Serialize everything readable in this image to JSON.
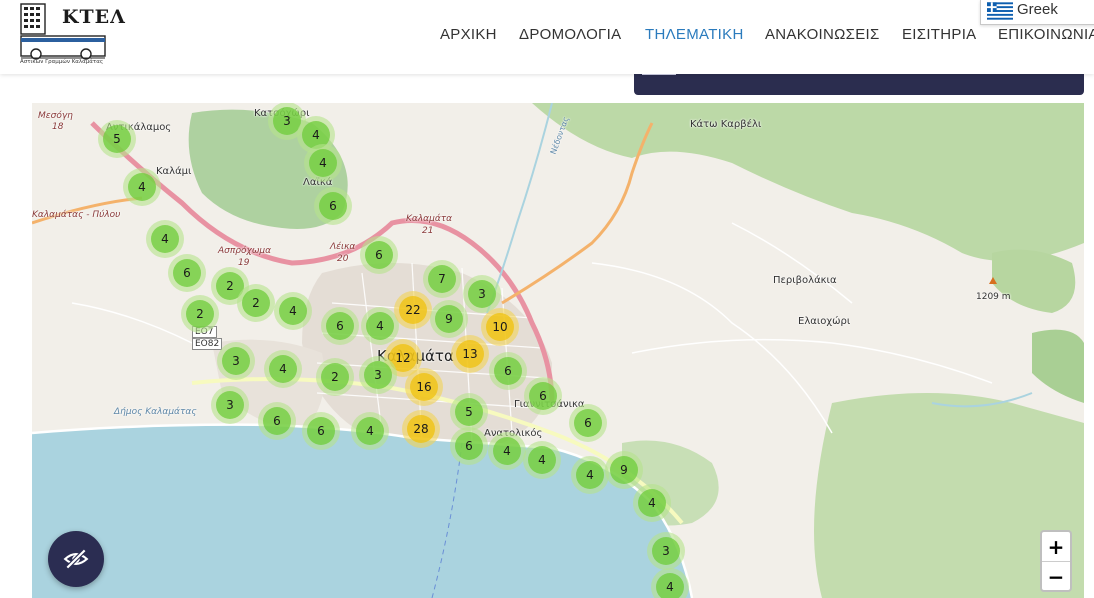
{
  "header": {
    "logo_text": "ΚΤΕΛ",
    "logo_subtitle": "Αστικών Γραμμών Καλαμάτας",
    "nav": [
      {
        "label": "ΑΡΧΙΚΗ",
        "active": false
      },
      {
        "label": "ΔΡΟΜΟΛΟΓΙΑ",
        "active": false
      },
      {
        "label": "ΤΗΛΕΜΑΤΙΚΗ",
        "active": true
      },
      {
        "label": "ΑΝΑΚΟΙΝΩΣΕΙΣ",
        "active": false
      },
      {
        "label": "ΕΙΣΙΤΗΡΙΑ",
        "active": false
      },
      {
        "label": "ΕΠΙΚΟΙΝΩΝΙΑ",
        "active": false
      }
    ],
    "language": "Greek",
    "accent_color": "#2b7bbd"
  },
  "map": {
    "labels": {
      "mesogi": "Μεσόγη",
      "mesogi_num": "18",
      "antikalamos": "Αντικάλαμος",
      "kalami": "Καλάμι",
      "katoxori": "Κατσόχώρι",
      "laika": "Λαϊκά",
      "road_pylos": "Καλαμάτας - Πύλου",
      "aspro": "Ασπρόχωμα",
      "aspro_num": "19",
      "leika": "Λέικα",
      "leika_num": "20",
      "kalamata_road": "Καλαμάτα",
      "kalamata_road_num": "21",
      "kato_karveli": "Κάτω Καρβέλι",
      "perivolakia": "Περιβολάκια",
      "elaioxori": "Ελαιοχώρι",
      "peak": "1209 m",
      "eo7": "ΕΟ7",
      "eo82": "ΕΟ82",
      "dimos": "Δήμος Καλαμάτας",
      "city": "Καλαμάτα",
      "giannitsanika": "Γιαννιτσάνικα",
      "anatolikos": "Ανατολικός",
      "nedontas": "Νέδοντας"
    },
    "clusters": [
      {
        "count": "5",
        "size": "small"
      },
      {
        "count": "3",
        "size": "small"
      },
      {
        "count": "4",
        "size": "small"
      },
      {
        "count": "4",
        "size": "small"
      },
      {
        "count": "4",
        "size": "small"
      },
      {
        "count": "6",
        "size": "small"
      },
      {
        "count": "4",
        "size": "small"
      },
      {
        "count": "6",
        "size": "small"
      },
      {
        "count": "6",
        "size": "small"
      },
      {
        "count": "2",
        "size": "small"
      },
      {
        "count": "2",
        "size": "small"
      },
      {
        "count": "2",
        "size": "small"
      },
      {
        "count": "4",
        "size": "small"
      },
      {
        "count": "6",
        "size": "small"
      },
      {
        "count": "4",
        "size": "small"
      },
      {
        "count": "7",
        "size": "small"
      },
      {
        "count": "3",
        "size": "small"
      },
      {
        "count": "22",
        "size": "medium"
      },
      {
        "count": "9",
        "size": "small"
      },
      {
        "count": "10",
        "size": "medium"
      },
      {
        "count": "13",
        "size": "medium"
      },
      {
        "count": "12",
        "size": "medium"
      },
      {
        "count": "3",
        "size": "small"
      },
      {
        "count": "4",
        "size": "small"
      },
      {
        "count": "2",
        "size": "small"
      },
      {
        "count": "3",
        "size": "small"
      },
      {
        "count": "16",
        "size": "medium"
      },
      {
        "count": "6",
        "size": "small"
      },
      {
        "count": "6",
        "size": "small"
      },
      {
        "count": "3",
        "size": "small"
      },
      {
        "count": "5",
        "size": "small"
      },
      {
        "count": "6",
        "size": "small"
      },
      {
        "count": "6",
        "size": "small"
      },
      {
        "count": "4",
        "size": "small"
      },
      {
        "count": "28",
        "size": "medium"
      },
      {
        "count": "6",
        "size": "small"
      },
      {
        "count": "4",
        "size": "small"
      },
      {
        "count": "4",
        "size": "small"
      },
      {
        "count": "6",
        "size": "small"
      },
      {
        "count": "4",
        "size": "small"
      },
      {
        "count": "9",
        "size": "small"
      },
      {
        "count": "4",
        "size": "small"
      },
      {
        "count": "3",
        "size": "small"
      },
      {
        "count": "4",
        "size": "small"
      }
    ],
    "zoom_in": "+",
    "zoom_out": "−"
  }
}
